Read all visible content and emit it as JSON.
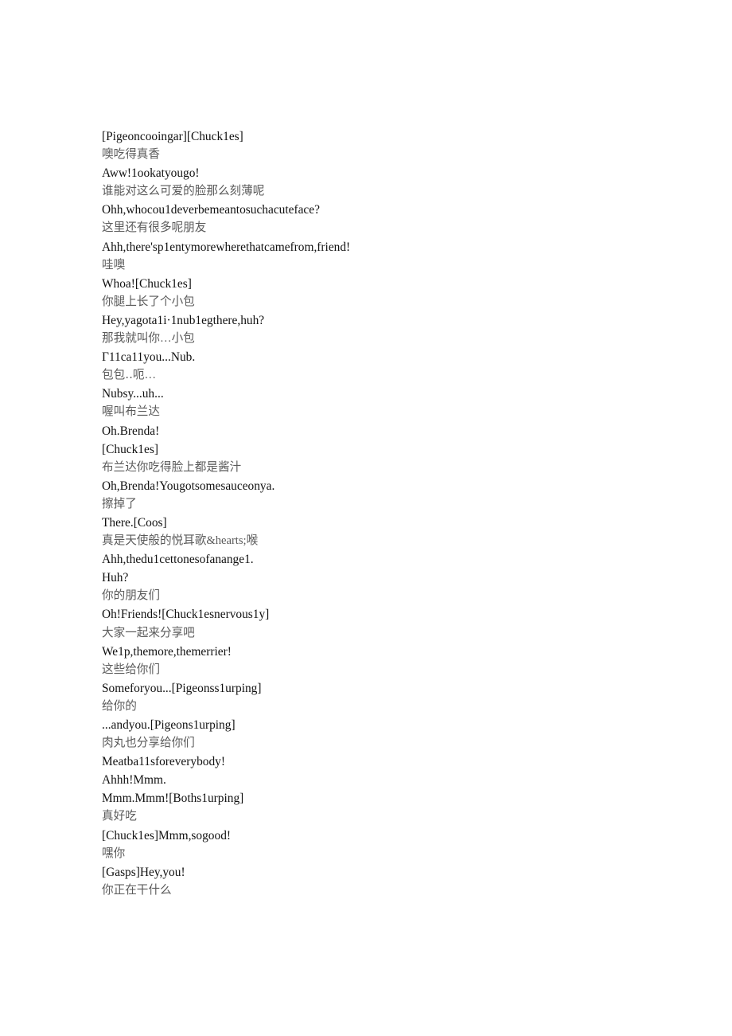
{
  "document": {
    "background_color": "#ffffff",
    "text_color_english": "#111111",
    "text_color_chinese": "#5a5a5a",
    "lines": [
      {
        "lang": "en",
        "text": "[Pigeoncooingar][Chuck1es]"
      },
      {
        "lang": "zh",
        "text": "噢吃得真香"
      },
      {
        "lang": "en",
        "text": "Aww!1ookatyougo!"
      },
      {
        "lang": "zh",
        "text": "谁能对这么可爱的脸那么刻薄呢"
      },
      {
        "lang": "en",
        "text": "Ohh,whocou1deverbemeantosuchacuteface?"
      },
      {
        "lang": "zh",
        "text": "这里还有很多呢朋友"
      },
      {
        "lang": "en",
        "text": "Ahh,there'sp1entymorewherethatcamefrom,friend!"
      },
      {
        "lang": "zh",
        "text": "哇噢"
      },
      {
        "lang": "en",
        "text": "Whoa![Chuck1es]"
      },
      {
        "lang": "zh",
        "text": "你腿上长了个小包"
      },
      {
        "lang": "en",
        "text": "Hey,yagota1i·1nub1egthere,huh?"
      },
      {
        "lang": "zh",
        "text": "那我就叫你…小包"
      },
      {
        "lang": "en",
        "text": "Γ11ca11you...Nub."
      },
      {
        "lang": "zh",
        "text": "包包‥呃…"
      },
      {
        "lang": "en",
        "text": "Nubsy...uh..."
      },
      {
        "lang": "zh",
        "text": "喔叫布兰达"
      },
      {
        "lang": "en",
        "text": "Oh.Brenda!"
      },
      {
        "lang": "en",
        "text": "[Chuck1es]"
      },
      {
        "lang": "zh",
        "text": "布兰达你吃得脸上都是酱汁"
      },
      {
        "lang": "en",
        "text": "Oh,Brenda!Yougotsomesauceonya."
      },
      {
        "lang": "zh",
        "text": "擦掉了"
      },
      {
        "lang": "en",
        "text": "There.[Coos]"
      },
      {
        "lang": "zh",
        "text": "真是天使般的悦耳歌&hearts;喉"
      },
      {
        "lang": "en",
        "text": "Ahh,thedu1cettonesofanange1."
      },
      {
        "lang": "en",
        "text": "Huh?"
      },
      {
        "lang": "zh",
        "text": "你的朋友们"
      },
      {
        "lang": "en",
        "text": "Oh!Friends![Chuck1esnervous1y]"
      },
      {
        "lang": "zh",
        "text": "大家一起来分享吧"
      },
      {
        "lang": "en",
        "text": "We1p,themore,themerrier!"
      },
      {
        "lang": "zh",
        "text": "这些给你们"
      },
      {
        "lang": "en",
        "text": "Someforyou...[Pigeonss1urping]"
      },
      {
        "lang": "zh",
        "text": "给你的"
      },
      {
        "lang": "en",
        "text": "...andyou.[Pigeons1urping]"
      },
      {
        "lang": "zh",
        "text": "肉丸也分享给你们"
      },
      {
        "lang": "en",
        "text": "Meatba11sforeverybody!"
      },
      {
        "lang": "en",
        "text": "Ahhh!Mmm."
      },
      {
        "lang": "en",
        "text": "Mmm.Mmm![Boths1urping]"
      },
      {
        "lang": "zh",
        "text": "真好吃"
      },
      {
        "lang": "en",
        "text": "[Chuck1es]Mmm,sogood!"
      },
      {
        "lang": "zh",
        "text": "嘿你"
      },
      {
        "lang": "en",
        "text": "[Gasps]Hey,you!"
      },
      {
        "lang": "zh",
        "text": "你正在干什么"
      }
    ]
  }
}
